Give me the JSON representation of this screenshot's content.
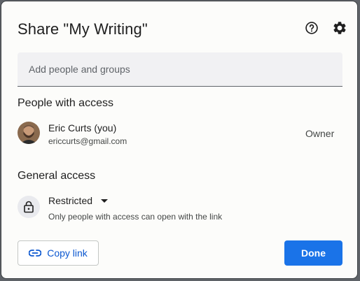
{
  "dialog": {
    "title": "Share \"My Writing\"",
    "help_icon": "help-circle-icon",
    "settings_icon": "gear-icon"
  },
  "add_people": {
    "placeholder": "Add people and groups",
    "value": ""
  },
  "people_section": {
    "heading": "People with access",
    "people": [
      {
        "name": "Eric Curts (you)",
        "email": "ericcurts@gmail.com",
        "role": "Owner",
        "avatar_icon": "user-avatar"
      }
    ]
  },
  "general_access": {
    "heading": "General access",
    "icon": "lock-icon",
    "selected": "Restricted",
    "description": "Only people with access can open with the link"
  },
  "footer": {
    "copy_link_label": "Copy link",
    "copy_link_icon": "link-icon",
    "done_label": "Done"
  },
  "colors": {
    "accent": "#1a73e8",
    "link_text": "#0b57d0",
    "surface": "#fcfcfa",
    "input_bg": "#f1f1f3"
  }
}
